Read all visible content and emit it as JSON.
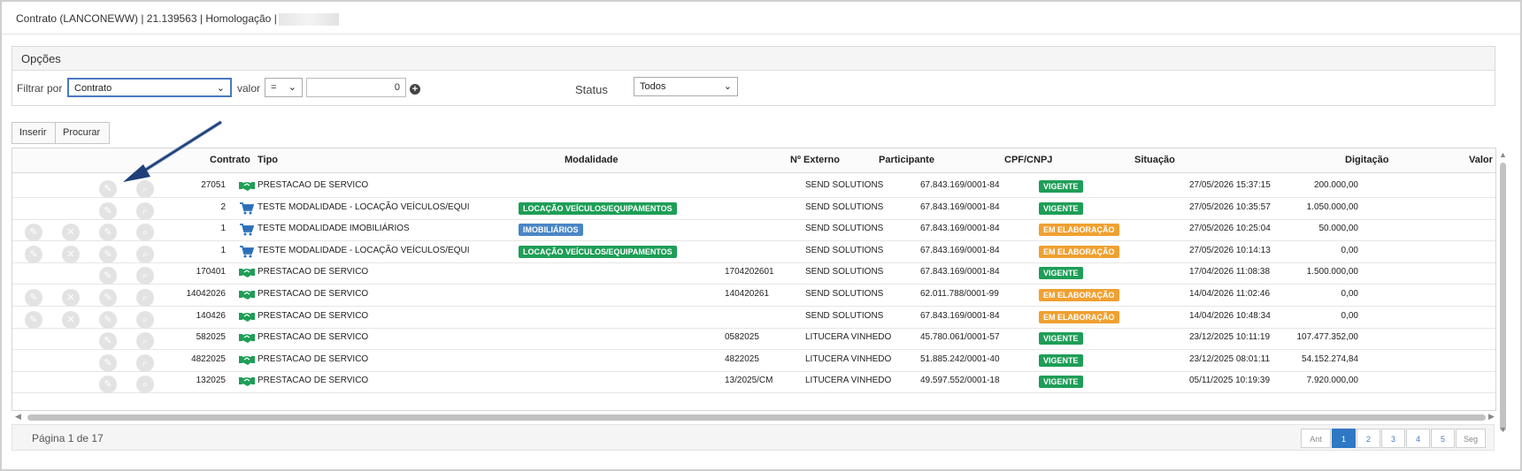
{
  "title": "Contrato (LANCONEWW) | 21.139563 | Homologação |",
  "opcoes": {
    "header": "Opções",
    "filtrar_label": "Filtrar por",
    "filtrar_value": "Contrato",
    "valor_label": "valor",
    "operator_value": "=",
    "valor_input": "0",
    "status_label": "Status",
    "status_value": "Todos"
  },
  "toolbar": {
    "inserir": "Inserir",
    "procurar": "Procurar"
  },
  "columns": [
    "Contrato",
    "Tipo",
    "Modalidade",
    "Nº Externo",
    "Participante",
    "CPF/CNPJ",
    "Situação",
    "Digitação",
    "Valor"
  ],
  "rows": [
    {
      "contrato": "27051",
      "tipo": "PRESTACAO DE SERVICO",
      "tipo_icon": "handshake-icon",
      "modalidade": "",
      "externo": "",
      "participante": "SEND SOLUTIONS",
      "cpf": "67.843.169/0001-84",
      "situacao": "VIGENTE",
      "situacao_color": "#1e9e57",
      "digitacao": "27/05/2026 15:37:15",
      "valor": "200.000,00",
      "edit_delete": false
    },
    {
      "contrato": "2",
      "tipo": "TESTE MODALIDADE - LOCAÇÃO VEÍCULOS/EQUI",
      "tipo_icon": "cart-icon",
      "modalidade": "LOCAÇÃO VEÍCULOS/EQUIPAMENTOS",
      "modalidade_color": "#1e9e57",
      "externo": "",
      "participante": "SEND SOLUTIONS",
      "cpf": "67.843.169/0001-84",
      "situacao": "VIGENTE",
      "situacao_color": "#1e9e57",
      "digitacao": "27/05/2026 10:35:57",
      "valor": "1.050.000,00",
      "edit_delete": false
    },
    {
      "contrato": "1",
      "tipo": "TESTE MODALIDADE IMOBILIÁRIOS",
      "tipo_icon": "cart-icon",
      "modalidade": "IMOBILIÁRIOS",
      "modalidade_color": "#4a86c5",
      "externo": "",
      "participante": "SEND SOLUTIONS",
      "cpf": "67.843.169/0001-84",
      "situacao": "EM ELABORAÇÃO",
      "situacao_color": "#f0a030",
      "digitacao": "27/05/2026 10:25:04",
      "valor": "50.000,00",
      "edit_delete": true
    },
    {
      "contrato": "1",
      "tipo": "TESTE MODALIDADE - LOCAÇÃO VEÍCULOS/EQUI",
      "tipo_icon": "cart-icon",
      "modalidade": "LOCAÇÃO VEÍCULOS/EQUIPAMENTOS",
      "modalidade_color": "#1e9e57",
      "externo": "",
      "participante": "SEND SOLUTIONS",
      "cpf": "67.843.169/0001-84",
      "situacao": "EM ELABORAÇÃO",
      "situacao_color": "#f0a030",
      "digitacao": "27/05/2026 10:14:13",
      "valor": "0,00",
      "edit_delete": true
    },
    {
      "contrato": "170401",
      "tipo": "PRESTACAO DE SERVICO",
      "tipo_icon": "handshake-icon",
      "modalidade": "",
      "externo": "1704202601",
      "participante": "SEND SOLUTIONS",
      "cpf": "67.843.169/0001-84",
      "situacao": "VIGENTE",
      "situacao_color": "#1e9e57",
      "digitacao": "17/04/2026 11:08:38",
      "valor": "1.500.000,00",
      "edit_delete": false
    },
    {
      "contrato": "14042026",
      "tipo": "PRESTACAO DE SERVICO",
      "tipo_icon": "handshake-icon",
      "modalidade": "",
      "externo": "140420261",
      "participante": "SEND SOLUTIONS",
      "cpf": "62.011.788/0001-99",
      "situacao": "EM ELABORAÇÃO",
      "situacao_color": "#f0a030",
      "digitacao": "14/04/2026 11:02:46",
      "valor": "0,00",
      "edit_delete": true
    },
    {
      "contrato": "140426",
      "tipo": "PRESTACAO DE SERVICO",
      "tipo_icon": "handshake-icon",
      "modalidade": "",
      "externo": "",
      "participante": "SEND SOLUTIONS",
      "cpf": "67.843.169/0001-84",
      "situacao": "EM ELABORAÇÃO",
      "situacao_color": "#f0a030",
      "digitacao": "14/04/2026 10:48:34",
      "valor": "0,00",
      "edit_delete": true
    },
    {
      "contrato": "582025",
      "tipo": "PRESTACAO DE SERVICO",
      "tipo_icon": "handshake-icon",
      "modalidade": "",
      "externo": "0582025",
      "participante": "LITUCERA VINHEDO",
      "cpf": "45.780.061/0001-57",
      "situacao": "VIGENTE",
      "situacao_color": "#1e9e57",
      "digitacao": "23/12/2025 10:11:19",
      "valor": "107.477.352,00",
      "edit_delete": false
    },
    {
      "contrato": "4822025",
      "tipo": "PRESTACAO DE SERVICO",
      "tipo_icon": "handshake-icon",
      "modalidade": "",
      "externo": "4822025",
      "participante": "LITUCERA VINHEDO",
      "cpf": "51.885.242/0001-40",
      "situacao": "VIGENTE",
      "situacao_color": "#1e9e57",
      "digitacao": "23/12/2025 08:01:11",
      "valor": "54.152.274,84",
      "edit_delete": false
    },
    {
      "contrato": "132025",
      "tipo": "PRESTACAO DE SERVICO",
      "tipo_icon": "handshake-icon",
      "modalidade": "",
      "externo": "13/2025/CM",
      "participante": "LITUCERA VINHEDO",
      "cpf": "49.597.552/0001-18",
      "situacao": "VIGENTE",
      "situacao_color": "#1e9e57",
      "digitacao": "05/11/2025 10:19:39",
      "valor": "7.920.000,00",
      "edit_delete": false
    }
  ],
  "footer": {
    "page_text": "Página 1 de 17"
  },
  "pager": [
    "Ant",
    "1",
    "2",
    "3",
    "4",
    "5",
    "Seg"
  ],
  "pager_active": "1"
}
